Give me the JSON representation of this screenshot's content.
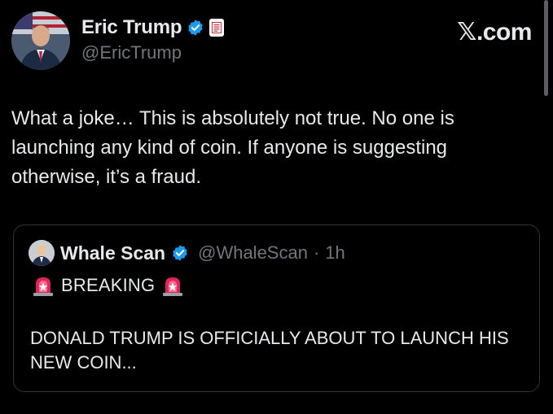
{
  "author": {
    "display_name": "Eric Trump",
    "handle": "@EricTrump"
  },
  "brand": "𝕏.com",
  "tweet": {
    "text": "What a joke… This is absolutely not true. No one is launching any kind of coin. If anyone is suggesting otherwise, it’s a fraud."
  },
  "quoted_tweet": {
    "display_name": "Whale Scan",
    "handle": "@WhaleScan",
    "separator": "·",
    "time": "1h",
    "headline": "BREAKING",
    "body": "DONALD TRUMP IS OFFICIALLY ABOUT TO LAUNCH HIS NEW COIN..."
  },
  "colors": {
    "background": "#000000",
    "text": "#e7e9ea",
    "muted": "#71767b",
    "verified": "#1d9bf0",
    "siren": "#e0245e"
  },
  "icons": {
    "verified": "verified-badge-icon",
    "affiliation": "affiliation-badge-icon",
    "siren": "police-siren-icon"
  }
}
